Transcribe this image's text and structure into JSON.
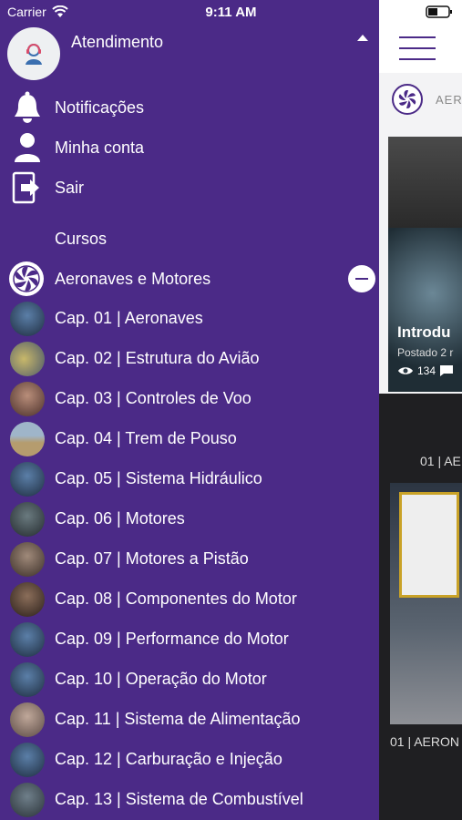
{
  "status_bar": {
    "carrier": "Carrier",
    "time": "9:11 AM"
  },
  "drawer": {
    "profile_name": "Atendimento",
    "menu": [
      {
        "label": "Notificações",
        "icon": "bell-icon"
      },
      {
        "label": "Minha conta",
        "icon": "person-icon"
      },
      {
        "label": "Sair",
        "icon": "logout-icon"
      }
    ],
    "courses_heading": "Cursos",
    "course": {
      "label": "Aeronaves e Motores",
      "icon": "turbine-logo-icon"
    },
    "chapters": [
      "Cap. 01 | Aeronaves",
      "Cap. 02 | Estrutura do Avião",
      "Cap. 03 | Controles de Voo",
      "Cap. 04 | Trem de Pouso",
      "Cap. 05 | Sistema Hidráulico",
      "Cap. 06 | Motores",
      "Cap. 07 | Motores a Pistão",
      "Cap. 08 | Componentes do Motor",
      "Cap. 09 | Performance do Motor",
      "Cap. 10 | Operação do Motor",
      "Cap. 11 | Sistema de Alimentação",
      "Cap. 12 | Carburação e Injeção",
      "Cap. 13 | Sistema de Combustível"
    ],
    "colors": {
      "background": "#4b2a87",
      "text": "#ffffff"
    }
  },
  "content": {
    "brand": "AER",
    "card_title": "Introdu",
    "card_posted": "Postado 2 r",
    "card_views": "134",
    "section_label": "01 | AE",
    "video_label": "01 | AERON"
  }
}
